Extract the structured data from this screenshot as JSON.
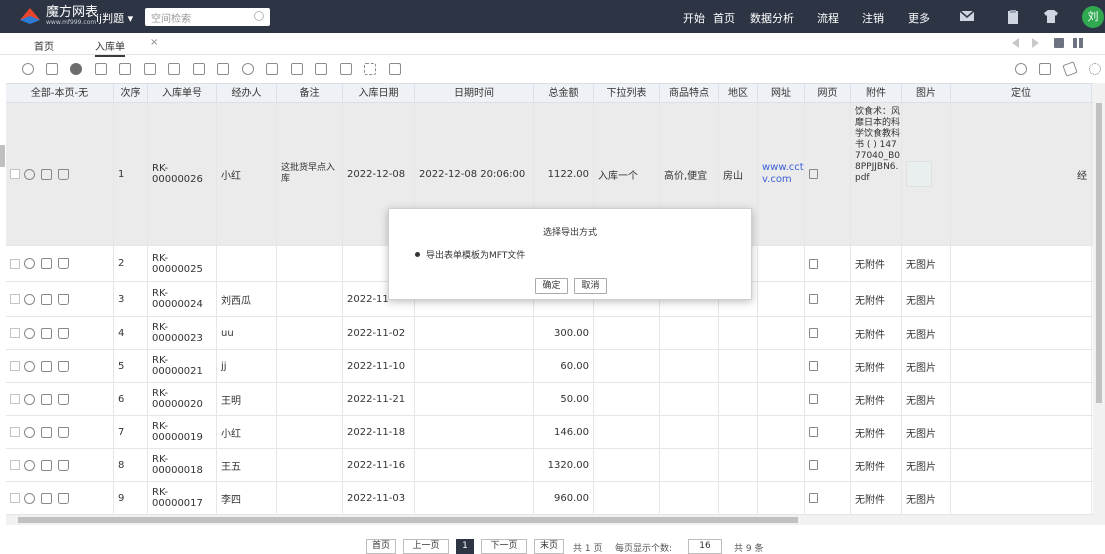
{
  "app": {
    "logo_text": "魔方网表",
    "logo_sub": "www.mf999.com",
    "project": "ij判题 ▾",
    "search_placeholder": "空间检索",
    "nav": [
      "开始",
      "首页",
      "数据分析",
      "流程",
      "注销",
      "更多"
    ],
    "avatar": "刘",
    "brand_color": "#2d3545"
  },
  "tabs": {
    "home": "首页",
    "active": "入库单",
    "close": "×"
  },
  "table": {
    "headers": [
      "全部-本页-无",
      "次序",
      "入库单号",
      "经办人",
      "备注",
      "入库日期",
      "日期时间",
      "总金额",
      "下拉列表",
      "商品特点",
      "地区",
      "网址",
      "网页",
      "附件",
      "图片",
      "定位"
    ],
    "rows": [
      {
        "seq": "1",
        "no": "RK-00000026",
        "handler": "小红",
        "note": "这批货早点入库",
        "date": "2022-12-08",
        "datetime": "2022-12-08 20:06:00",
        "amount": "1122.00",
        "dropdown": "入库一个",
        "feature": "高价,便宜",
        "region": "房山",
        "url": "www.cctv.com",
        "attachment": "饮食术：风靡日本的科学饮食教科书 ( ) 14777040_B08PPJJBN6.pdf",
        "image": "",
        "loc": "经"
      },
      {
        "seq": "2",
        "no": "RK-00000025",
        "handler": "",
        "note": "",
        "date": "",
        "datetime": "",
        "amount": "",
        "dropdown": "",
        "feature": "",
        "region": "",
        "url": "",
        "attachment": "无附件",
        "image": "无图片",
        "loc": ""
      },
      {
        "seq": "3",
        "no": "RK-00000024",
        "handler": "刘西瓜",
        "note": "",
        "date": "2022-11-",
        "datetime": "",
        "amount": "",
        "dropdown": "",
        "feature": "",
        "region": "",
        "url": "",
        "attachment": "无附件",
        "image": "无图片",
        "loc": ""
      },
      {
        "seq": "4",
        "no": "RK-00000023",
        "handler": "uu",
        "note": "",
        "date": "2022-11-02",
        "datetime": "",
        "amount": "300.00",
        "dropdown": "",
        "feature": "",
        "region": "",
        "url": "",
        "attachment": "无附件",
        "image": "无图片",
        "loc": ""
      },
      {
        "seq": "5",
        "no": "RK-00000021",
        "handler": "jj",
        "note": "",
        "date": "2022-11-10",
        "datetime": "",
        "amount": "60.00",
        "dropdown": "",
        "feature": "",
        "region": "",
        "url": "",
        "attachment": "无附件",
        "image": "无图片",
        "loc": ""
      },
      {
        "seq": "6",
        "no": "RK-00000020",
        "handler": "王明",
        "note": "",
        "date": "2022-11-21",
        "datetime": "",
        "amount": "50.00",
        "dropdown": "",
        "feature": "",
        "region": "",
        "url": "",
        "attachment": "无附件",
        "image": "无图片",
        "loc": ""
      },
      {
        "seq": "7",
        "no": "RK-00000019",
        "handler": "小红",
        "note": "",
        "date": "2022-11-18",
        "datetime": "",
        "amount": "146.00",
        "dropdown": "",
        "feature": "",
        "region": "",
        "url": "",
        "attachment": "无附件",
        "image": "无图片",
        "loc": ""
      },
      {
        "seq": "8",
        "no": "RK-00000018",
        "handler": "王五",
        "note": "",
        "date": "2022-11-16",
        "datetime": "",
        "amount": "1320.00",
        "dropdown": "",
        "feature": "",
        "region": "",
        "url": "",
        "attachment": "无附件",
        "image": "无图片",
        "loc": ""
      },
      {
        "seq": "9",
        "no": "RK-00000017",
        "handler": "李四",
        "note": "",
        "date": "2022-11-03",
        "datetime": "",
        "amount": "960.00",
        "dropdown": "",
        "feature": "",
        "region": "",
        "url": "",
        "attachment": "无附件",
        "image": "无图片",
        "loc": ""
      }
    ]
  },
  "pager": {
    "first": "首页",
    "prev": "上一页",
    "current": "1",
    "next": "下一页",
    "last": "末页",
    "total_pages": "共 1 页",
    "per_page_label": "每页显示个数:",
    "per_page": "16",
    "total_items": "共 9 条"
  },
  "modal": {
    "title": "选择导出方式",
    "option": "导出表单模板为MFT文件",
    "confirm": "确定",
    "cancel": "取消"
  },
  "icons": {
    "toolbar_left": [
      "refresh-icon",
      "preview-icon",
      "add-icon",
      "import-icon",
      "export-icon",
      "print-icon",
      "print-preview-icon",
      "print-setting-icon",
      "export-form-icon",
      "share-icon",
      "copy-icon",
      "report-icon",
      "template-icon",
      "chart-icon",
      "fullscreen-icon",
      "layout-icon"
    ],
    "toolbar_right": [
      "search-icon",
      "filter-icon",
      "send-icon",
      "settings-icon"
    ],
    "topbar": [
      "mail-icon",
      "clipboard-icon",
      "shirt-icon"
    ]
  }
}
